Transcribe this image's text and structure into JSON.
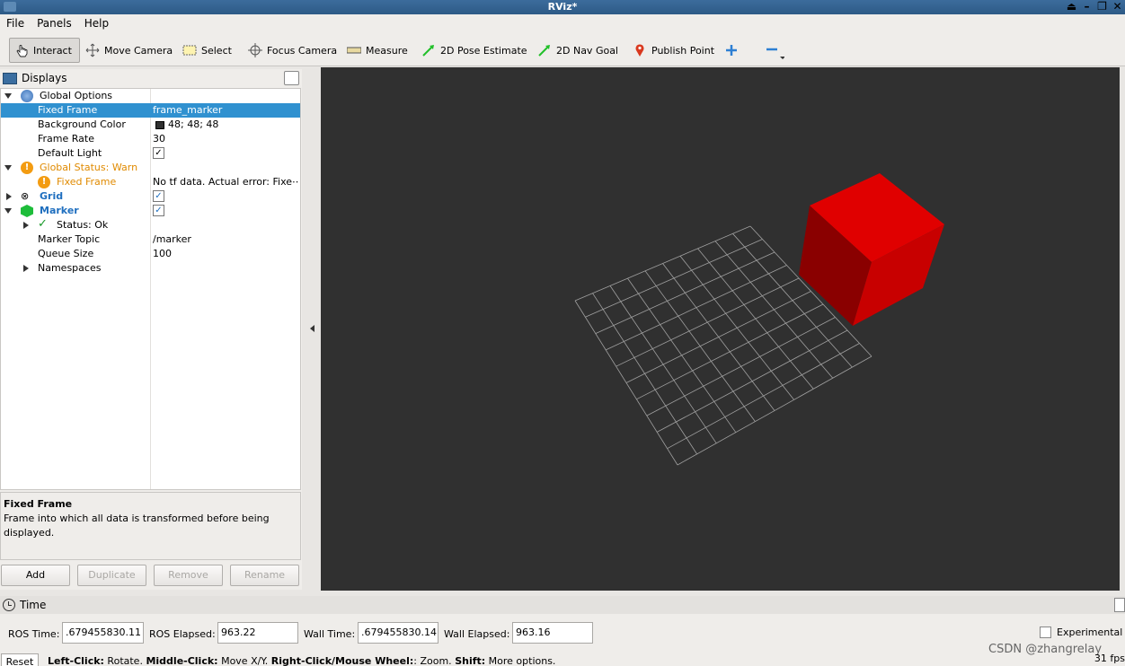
{
  "window": {
    "title": "RViz*"
  },
  "menu": [
    "File",
    "Panels",
    "Help"
  ],
  "toolbar": {
    "interact": "Interact",
    "move_camera": "Move Camera",
    "select": "Select",
    "focus_camera": "Focus Camera",
    "measure": "Measure",
    "pose_estimate": "2D Pose Estimate",
    "nav_goal": "2D Nav Goal",
    "publish_point": "Publish Point"
  },
  "displays": {
    "title": "Displays",
    "rows": {
      "global_options": "Global Options",
      "fixed_frame": {
        "name": "Fixed Frame",
        "value": "frame_marker"
      },
      "background_color": {
        "name": "Background Color",
        "value": "48; 48; 48"
      },
      "frame_rate": {
        "name": "Frame Rate",
        "value": "30"
      },
      "default_light": {
        "name": "Default Light"
      },
      "global_status": "Global Status: Warn",
      "status_fixed_frame": {
        "name": "Fixed Frame",
        "value": "No tf data.  Actual error: Fixe⋯"
      },
      "grid": "Grid",
      "marker": "Marker",
      "status_ok": "Status: Ok",
      "marker_topic": {
        "name": "Marker Topic",
        "value": "/marker"
      },
      "queue_size": {
        "name": "Queue Size",
        "value": "100"
      },
      "namespaces": "Namespaces"
    },
    "help": {
      "title": "Fixed Frame",
      "text": "Frame into which all data is transformed before being displayed."
    },
    "buttons": {
      "add": "Add",
      "duplicate": "Duplicate",
      "remove": "Remove",
      "rename": "Rename"
    }
  },
  "time": {
    "title": "Time",
    "ros_time_label": "ROS Time:",
    "ros_time": ".679455830.11",
    "ros_elapsed_label": "ROS Elapsed:",
    "ros_elapsed": "963.22",
    "wall_time_label": "Wall Time:",
    "wall_time": ".679455830.14",
    "wall_elapsed_label": "Wall Elapsed:",
    "wall_elapsed": "963.16",
    "experimental": "Experimental"
  },
  "status": {
    "reset": "Reset",
    "left_click": "Left-Click:",
    "left_click_action": " Rotate. ",
    "middle_click": "Middle-Click:",
    "middle_click_action": " Move X/Y. ",
    "right_click": "Right-Click/Mouse Wheel:",
    "right_click_action": ": Zoom. ",
    "shift": "Shift:",
    "shift_action": " More options.",
    "fps": "31 fps"
  },
  "watermark": "CSDN @zhangrelay",
  "colors": {
    "selection": "#3091d0",
    "warn": "#e08a00",
    "cube": "#e00000",
    "view_bg": "#303030"
  }
}
